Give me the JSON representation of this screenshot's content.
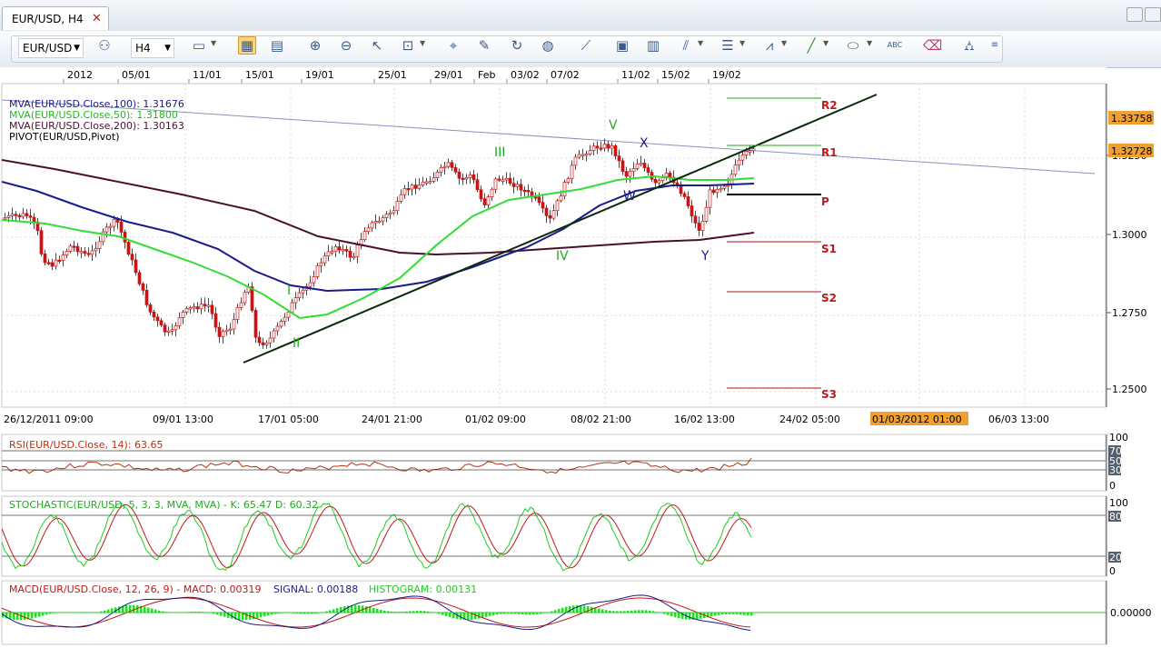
{
  "tab": {
    "title": "EUR/USD, H4",
    "close": "✕"
  },
  "toolbar": {
    "symbol": "EUR/USD",
    "timeframe": "H4"
  },
  "top_dates": [
    "2012",
    "05/01",
    "11/01",
    "15/01",
    "19/01",
    "25/01",
    "29/01",
    "Feb",
    "03/02",
    "07/02",
    "11/02",
    "15/02",
    "19/02"
  ],
  "bottom_dates": [
    "26/12/2011 09:00",
    "09/01 13:00",
    "17/01 05:00",
    "24/01 21:00",
    "01/02 09:00",
    "08/02 21:00",
    "16/02 13:00",
    "24/02 05:00",
    "01/03/2012 01:00",
    "06/03 13:00"
  ],
  "legend": {
    "mva100": "MVA(EUR/USD.Close,100): 1.31676",
    "mva50": "MVA(EUR/USD.Close,50): 1.31800",
    "mva200": "MVA(EUR/USD.Close,200): 1.30163",
    "pivot": "PIVOT(EUR/USD,Pivot)"
  },
  "price_axis": [
    "1.3250",
    "1.3000",
    "1.2750",
    "1.2500"
  ],
  "price_markers": {
    "r2_value": "1.33758",
    "last_value": "1.32728"
  },
  "pivot_labels": [
    "R2",
    "R1",
    "P",
    "S1",
    "S2",
    "S3"
  ],
  "wave_labels": [
    "I",
    "II",
    "III",
    "IV",
    "V",
    "W",
    "X",
    "Y"
  ],
  "rsi": {
    "title": "RSI(EUR/USD.Close, 14): 63.65",
    "axis": [
      "100",
      "70",
      "50",
      "30",
      "0"
    ]
  },
  "stoch": {
    "title": "STOCHASTIC(EUR/USD, 5, 3, 3, MVA, MVA) -  K: 65.47  D: 60.32",
    "axis": [
      "100",
      "80",
      "20",
      "0"
    ]
  },
  "macd": {
    "title_a": "MACD(EUR/USD.Close, 12, 26, 9) -  MACD: 0.00319",
    "title_b": "SIGNAL: 0.00188",
    "title_c": "HISTOGRAM: 0.00131",
    "axis": "0.00000"
  },
  "colors": {
    "mva100": "#1a1a8c",
    "mva50": "#33dd33",
    "mva200": "#4a1030",
    "candle": "#c01818",
    "r_line": "#22aa22",
    "s_line": "#b01010",
    "highlight": "#f0a030"
  }
}
